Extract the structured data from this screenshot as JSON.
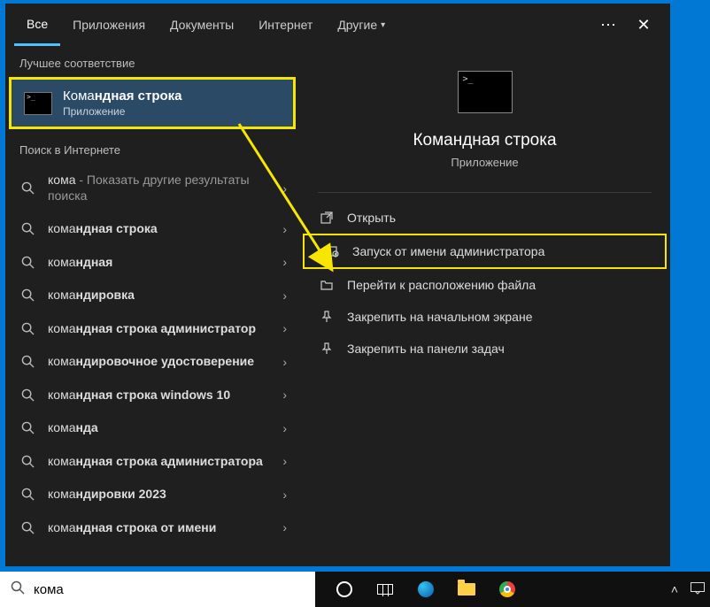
{
  "tabs": {
    "all": "Все",
    "apps": "Приложения",
    "docs": "Документы",
    "web": "Интернет",
    "more": "Другие"
  },
  "section_best": "Лучшее соответствие",
  "section_web": "Поиск в Интернете",
  "best_match": {
    "title_prefix": "Кома",
    "title_rest": "ндная строка",
    "subtitle": "Приложение"
  },
  "web_results": [
    {
      "prefix": "кома",
      "rest": "",
      "sub": " - Показать другие результаты поиска"
    },
    {
      "prefix": "кома",
      "rest": "ндная строка",
      "sub": ""
    },
    {
      "prefix": "кома",
      "rest": "ндная",
      "sub": ""
    },
    {
      "prefix": "кома",
      "rest": "ндировка",
      "sub": ""
    },
    {
      "prefix": "кома",
      "rest": "ндная строка администратор",
      "sub": ""
    },
    {
      "prefix": "кома",
      "rest": "ндировочное удостоверение",
      "sub": ""
    },
    {
      "prefix": "кома",
      "rest": "ндная строка windows 10",
      "sub": ""
    },
    {
      "prefix": "кома",
      "rest": "нда",
      "sub": ""
    },
    {
      "prefix": "кома",
      "rest": "ндная строка администратора",
      "sub": ""
    },
    {
      "prefix": "кома",
      "rest": "ндировки 2023",
      "sub": ""
    },
    {
      "prefix": "кома",
      "rest": "ндная строка от имени",
      "sub": ""
    }
  ],
  "preview": {
    "title": "Командная строка",
    "subtitle": "Приложение"
  },
  "actions": [
    {
      "icon": "open",
      "label": "Открыть",
      "hl": false
    },
    {
      "icon": "admin",
      "label": "Запуск от имени администратора",
      "hl": true
    },
    {
      "icon": "location",
      "label": "Перейти к расположению файла",
      "hl": false
    },
    {
      "icon": "pin-start",
      "label": "Закрепить на начальном экране",
      "hl": false
    },
    {
      "icon": "pin-task",
      "label": "Закрепить на панели задач",
      "hl": false
    }
  ],
  "search_value": "кома"
}
